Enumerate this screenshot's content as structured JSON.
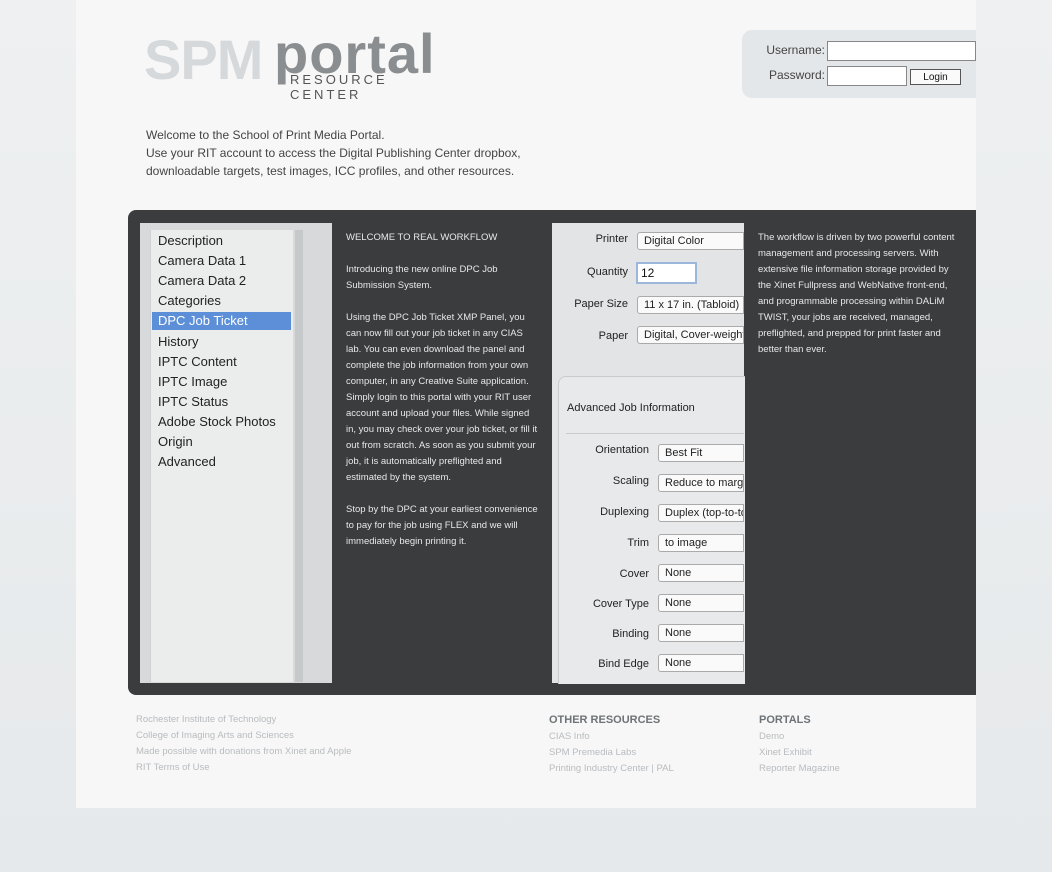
{
  "logo": {
    "spm": "SPM",
    "portal": "portal",
    "subtitle": "RESOURCE CENTER"
  },
  "login": {
    "username_label": "Username:",
    "password_label": "Password:",
    "username_value": "",
    "password_value": "",
    "login_button": "Login"
  },
  "welcome": {
    "line1": "Welcome to the School of Print Media Portal.",
    "line2": "Use your RIT account to access the Digital Publishing Center dropbox,",
    "line3": "downloadable targets, test images, ICC profiles, and other resources."
  },
  "sidebar": {
    "items": [
      {
        "label": "Description"
      },
      {
        "label": "Camera Data 1"
      },
      {
        "label": "Camera Data 2"
      },
      {
        "label": "Categories"
      },
      {
        "label": "DPC Job Ticket"
      },
      {
        "label": "History"
      },
      {
        "label": "IPTC Content"
      },
      {
        "label": "IPTC Image"
      },
      {
        "label": "IPTC Status"
      },
      {
        "label": "Adobe Stock Photos"
      },
      {
        "label": "Origin"
      },
      {
        "label": "Advanced"
      }
    ],
    "selected": "DPC Job Ticket"
  },
  "intro": {
    "heading": "WELCOME TO REAL WORKFLOW",
    "p1": "Introducing the new online DPC Job Submission System.",
    "p2": "Using the DPC Job Ticket XMP Panel, you can now fill out your job ticket in any CIAS lab. You can even download the panel and complete the job information from your own computer, in any Creative Suite application. Simply login to this portal with your RIT user account and upload your files. While signed in, you may check over your job ticket, or fill it out from scratch. As soon as you submit your job, it is automatically preflighted and estimated by the system.",
    "p3": "Stop by the DPC at your earliest convenience to pay for the job using FLEX and we will immediately begin printing it."
  },
  "form": {
    "printer_label": "Printer",
    "printer_value": "Digital Color",
    "quantity_label": "Quantity",
    "quantity_value": "12",
    "paper_size_label": "Paper Size",
    "paper_size_value": "11 x 17 in. (Tabloid)",
    "paper_label": "Paper",
    "paper_value": "Digital, Cover-weight",
    "advanced_title": "Advanced Job Information",
    "orientation_label": "Orientation",
    "orientation_value": "Best Fit",
    "scaling_label": "Scaling",
    "scaling_value": "Reduce to margins",
    "duplexing_label": "Duplexing",
    "duplexing_value": "Duplex (top-to-top)",
    "trim_label": "Trim",
    "trim_value": "to image",
    "cover_label": "Cover",
    "cover_value": "None",
    "cover_type_label": "Cover Type",
    "cover_type_value": "None",
    "binding_label": "Binding",
    "binding_value": "None",
    "bind_edge_label": "Bind Edge",
    "bind_edge_value": "None"
  },
  "right_text": "The workflow is driven by two powerful content management and processing servers. With extensive file information storage provided by the Xinet Fullpress and WebNative front-end, and programmable processing within DALiM TWIST, your jobs are received, managed, preflighted, and prepped for print faster and better than ever.",
  "footer": {
    "col1": [
      "Rochester Institute of Technology",
      "College of Imaging Arts and Sciences",
      "Made possible with donations from Xinet and Apple",
      "RIT Terms of Use"
    ],
    "other_resources_heading": "OTHER RESOURCES",
    "other_resources": [
      "CIAS Info",
      "SPM Premedia Labs",
      "Printing Industry Center | PAL"
    ],
    "portals_heading": "PORTALS",
    "portals": [
      "Demo",
      "Xinet Exhibit",
      "Reporter Magazine"
    ]
  }
}
